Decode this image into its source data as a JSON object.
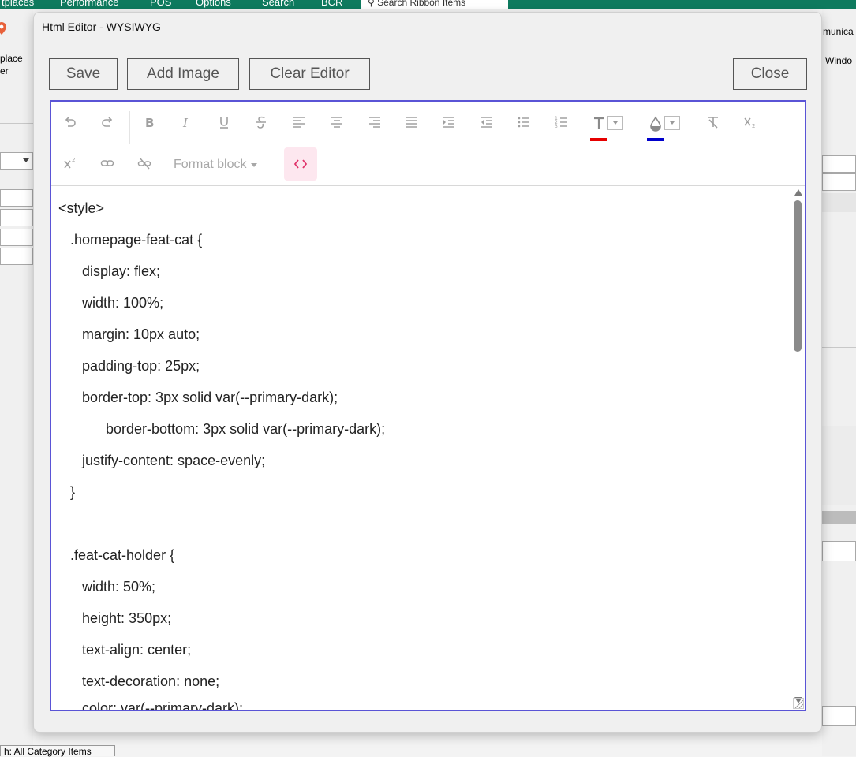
{
  "background": {
    "ribbon_tabs": [
      "tplaces",
      "Performance",
      "POS",
      "Options",
      "Search",
      "BCR"
    ],
    "search_placeholder": "Search Ribbon Items",
    "left_label_1": "place",
    "left_label_2": "er",
    "right_label_1": "munica",
    "right_label_2": "Windo",
    "bottom_tab": "h: All Category Items"
  },
  "dialog": {
    "title": "Html Editor - WYSIWYG",
    "buttons": {
      "save": "Save",
      "add_image": "Add Image",
      "clear_editor": "Clear Editor",
      "close": "Close"
    }
  },
  "toolbar": {
    "format_block": "Format block",
    "text_color": "#e60000",
    "highlight_color": "#0000cc",
    "active_color": "#e0336a",
    "editor_border": "#5a54d6"
  },
  "code_lines": [
    "<style>",
    "   .homepage-feat-cat {",
    "      display: flex;",
    "      width: 100%;",
    "      margin: 10px auto;",
    "      padding-top: 25px;",
    "      border-top: 3px solid var(--primary-dark);",
    "            border-bottom: 3px solid var(--primary-dark);",
    "      justify-content: space-evenly;",
    "   }",
    "",
    "   .feat-cat-holder {",
    "      width: 50%;",
    "      height: 350px;",
    "      text-align: center;",
    "      text-decoration: none;",
    "      color: var(--primary-dark);"
  ]
}
